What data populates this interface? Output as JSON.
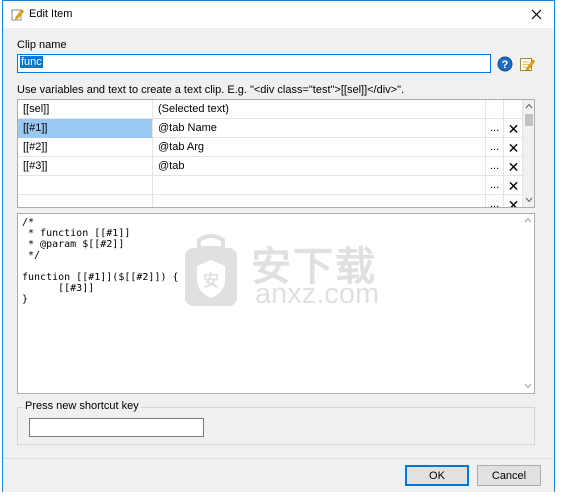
{
  "window": {
    "title": "Edit Item"
  },
  "clip": {
    "label": "Clip name",
    "value": "func"
  },
  "hint": "Use variables and text to create a text clip. E.g. \"<div class=\"test\">[[sel]]</div>\".",
  "variables": [
    {
      "name": "[[sel]]",
      "value": "(Selected text)",
      "more": "",
      "del": ""
    },
    {
      "name": "[[#1]]",
      "value": "@tab Name",
      "more": "...",
      "del": "✕"
    },
    {
      "name": "[[#2]]",
      "value": "@tab Arg",
      "more": "...",
      "del": "✕"
    },
    {
      "name": "[[#3]]",
      "value": "@tab",
      "more": "...",
      "del": "✕"
    },
    {
      "name": "",
      "value": "",
      "more": "...",
      "del": "✕"
    },
    {
      "name": "",
      "value": "",
      "more": "...",
      "del": "✕"
    }
  ],
  "code": "/*\n * function [[#1]]\n * @param $[[#2]]\n */\n\nfunction [[#1]]($[[#2]]) {\n      [[#3]]\n}",
  "watermark": {
    "text_cn": "安下载",
    "text_url": "anxz.com"
  },
  "shortcut": {
    "legend": "Press new shortcut key",
    "value": ""
  },
  "buttons": {
    "ok": "OK",
    "cancel": "Cancel"
  },
  "colors": {
    "accent": "#0078d7",
    "selection": "#99c9f2",
    "help_icon": "#1c6ec2"
  }
}
